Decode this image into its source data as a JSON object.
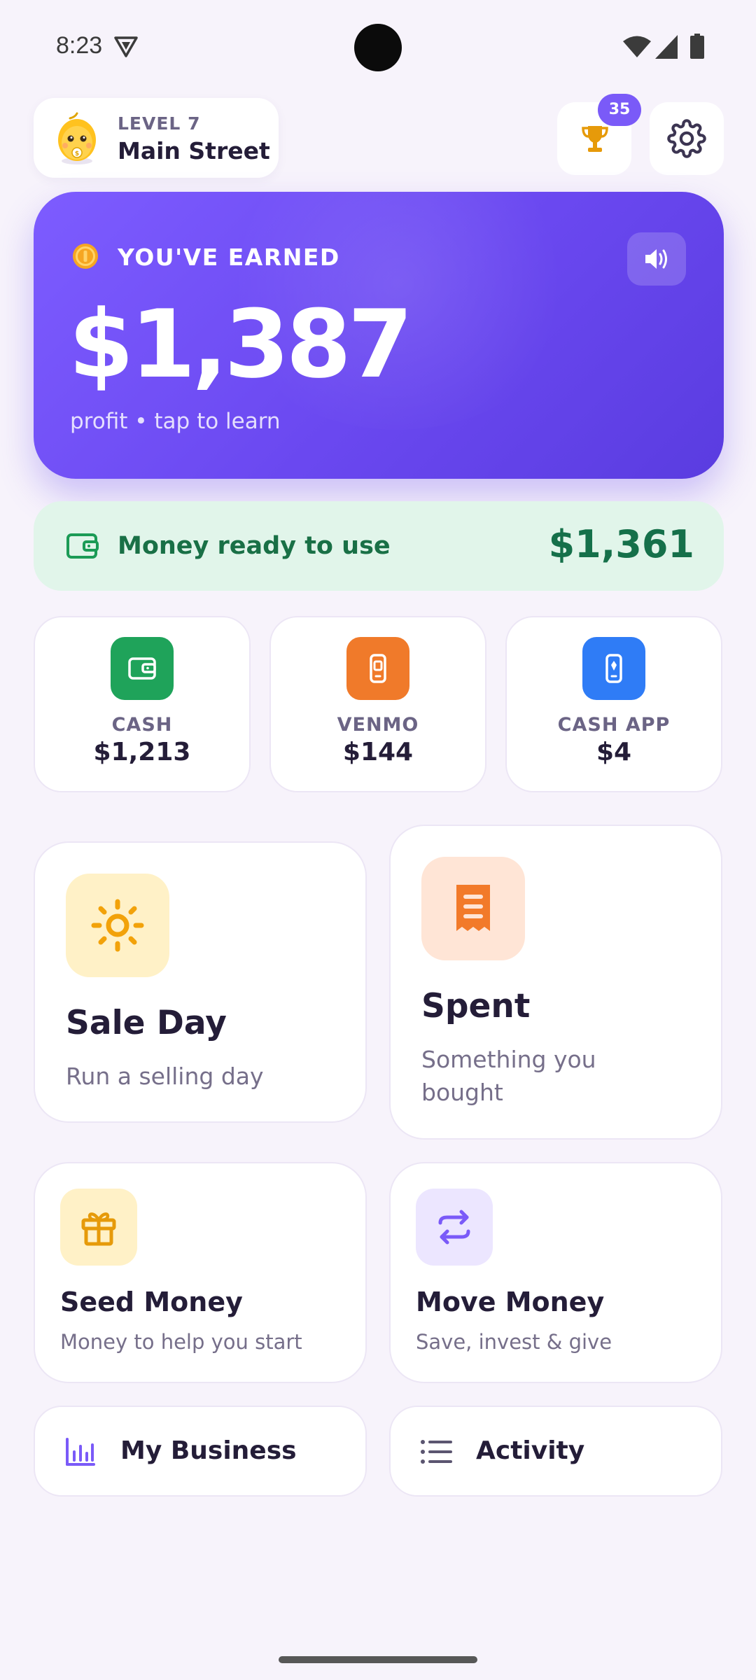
{
  "status_bar": {
    "time": "8:23"
  },
  "header": {
    "level_label": "LEVEL 7",
    "level_name": "Main Street",
    "trophy_badge": "35"
  },
  "earnings": {
    "label": "YOU'VE EARNED",
    "amount": "$1,387",
    "subtext": "profit • tap to learn"
  },
  "ready": {
    "label": "Money ready to use",
    "amount": "$1,361"
  },
  "accounts": [
    {
      "name": "CASH",
      "amount": "$1,213",
      "color": "#1fa35a",
      "icon": "wallet-icon"
    },
    {
      "name": "VENMO",
      "amount": "$144",
      "color": "#f07a2a",
      "icon": "phone-icon"
    },
    {
      "name": "CASH APP",
      "amount": "$4",
      "color": "#2f7cf6",
      "icon": "phone-icon"
    }
  ],
  "actions": {
    "sale_day": {
      "title": "Sale Day",
      "subtitle": "Run a selling day",
      "icon": "sun-icon"
    },
    "spent": {
      "title": "Spent",
      "subtitle_line1": "Something you",
      "subtitle_line2": "bought",
      "icon": "receipt-icon"
    },
    "seed_money": {
      "title": "Seed Money",
      "subtitle": "Money to help you start",
      "icon": "gift-icon"
    },
    "move_money": {
      "title": "Move Money",
      "subtitle": "Save, invest & give",
      "icon": "transfer-icon"
    }
  },
  "bottom_links": {
    "my_business": "My Business",
    "activity": "Activity"
  },
  "colors": {
    "accent": "#7a5af8",
    "success": "#15704a",
    "background": "#f7f3fb"
  }
}
